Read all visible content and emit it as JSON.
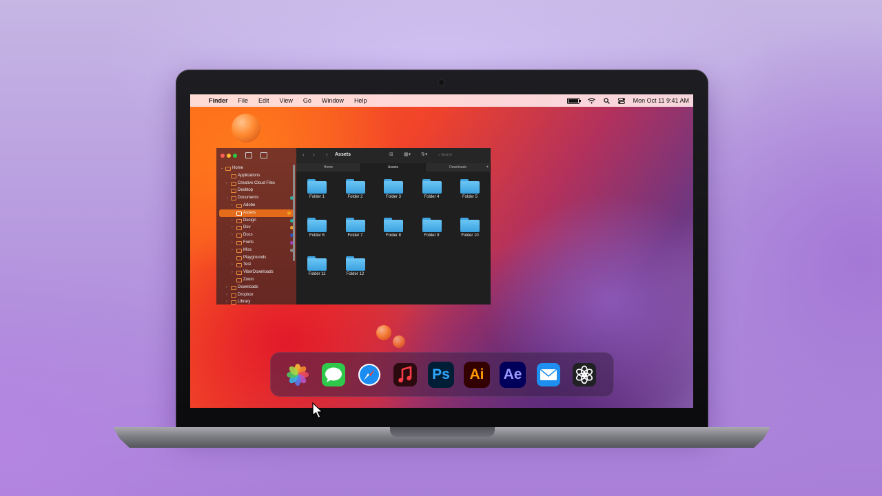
{
  "menubar": {
    "app_name": "Finder",
    "items": [
      "File",
      "Edit",
      "View",
      "Go",
      "Window",
      "Help"
    ],
    "clock": "Mon Oct 11  9:41 AM"
  },
  "finder": {
    "path_title": "Assets",
    "search_placeholder": "Search",
    "tabs": [
      "Home",
      "Assets",
      "Downloads"
    ],
    "active_tab": "Assets",
    "sidebar": [
      {
        "label": "Home",
        "indent": 0,
        "chev": "⌄"
      },
      {
        "label": "Applications",
        "indent": 1,
        "chev": ""
      },
      {
        "label": "Creative Cloud Files",
        "indent": 1,
        "chev": "›"
      },
      {
        "label": "Desktop",
        "indent": 1,
        "chev": ""
      },
      {
        "label": "Documents",
        "indent": 1,
        "chev": "⌄",
        "tag": "#2bb3a7"
      },
      {
        "label": "Adobe",
        "indent": 2,
        "chev": "›"
      },
      {
        "label": "Assets",
        "indent": 2,
        "chev": "›",
        "selected": true,
        "tag": "#f0a020"
      },
      {
        "label": "Design",
        "indent": 2,
        "chev": "›",
        "tag": "#2bb3a7"
      },
      {
        "label": "Dev",
        "indent": 2,
        "chev": "›",
        "tag": "#e6a12a"
      },
      {
        "label": "Docs",
        "indent": 2,
        "chev": "›",
        "tag": "#2a56c8"
      },
      {
        "label": "Fonts",
        "indent": 2,
        "chev": "›",
        "tag": "#a23fc0"
      },
      {
        "label": "Misc",
        "indent": 2,
        "chev": "›",
        "tag": "#8a8a8a"
      },
      {
        "label": "Playgrounds",
        "indent": 2,
        "chev": ""
      },
      {
        "label": "Test",
        "indent": 2,
        "chev": "›"
      },
      {
        "label": "ViberDownloads",
        "indent": 2,
        "chev": "›"
      },
      {
        "label": "Zoom",
        "indent": 2,
        "chev": ""
      },
      {
        "label": "Downloads",
        "indent": 1,
        "chev": "›"
      },
      {
        "label": "Dropbox",
        "indent": 1,
        "chev": "›"
      },
      {
        "label": "Library",
        "indent": 1,
        "chev": "›"
      }
    ],
    "folders": [
      "Folder 1",
      "Folder 2",
      "Folder 3",
      "Folder 4",
      "Folder 5",
      "Folder 6",
      "Folder 7",
      "Folder 8",
      "Folder 9",
      "Folder 10",
      "Folder 11",
      "Folder 12"
    ]
  },
  "dock": {
    "apps": [
      {
        "name": "photos-app-icon",
        "text": ""
      },
      {
        "name": "messages-app-icon",
        "text": ""
      },
      {
        "name": "safari-app-icon",
        "text": ""
      },
      {
        "name": "music-app-icon",
        "text": ""
      },
      {
        "name": "photoshop-app-icon",
        "text": "Ps",
        "color": "#31a8ff",
        "bg": "#001e36"
      },
      {
        "name": "illustrator-app-icon",
        "text": "Ai",
        "color": "#ff9a00",
        "bg": "#330000"
      },
      {
        "name": "after-effects-app-icon",
        "text": "Ae",
        "color": "#9999ff",
        "bg": "#00005b"
      },
      {
        "name": "mail-app-icon",
        "text": ""
      },
      {
        "name": "chatgpt-app-icon",
        "text": ""
      }
    ]
  },
  "colors": {
    "selection": "#e36b1a",
    "folder": "#4fb4ec"
  }
}
